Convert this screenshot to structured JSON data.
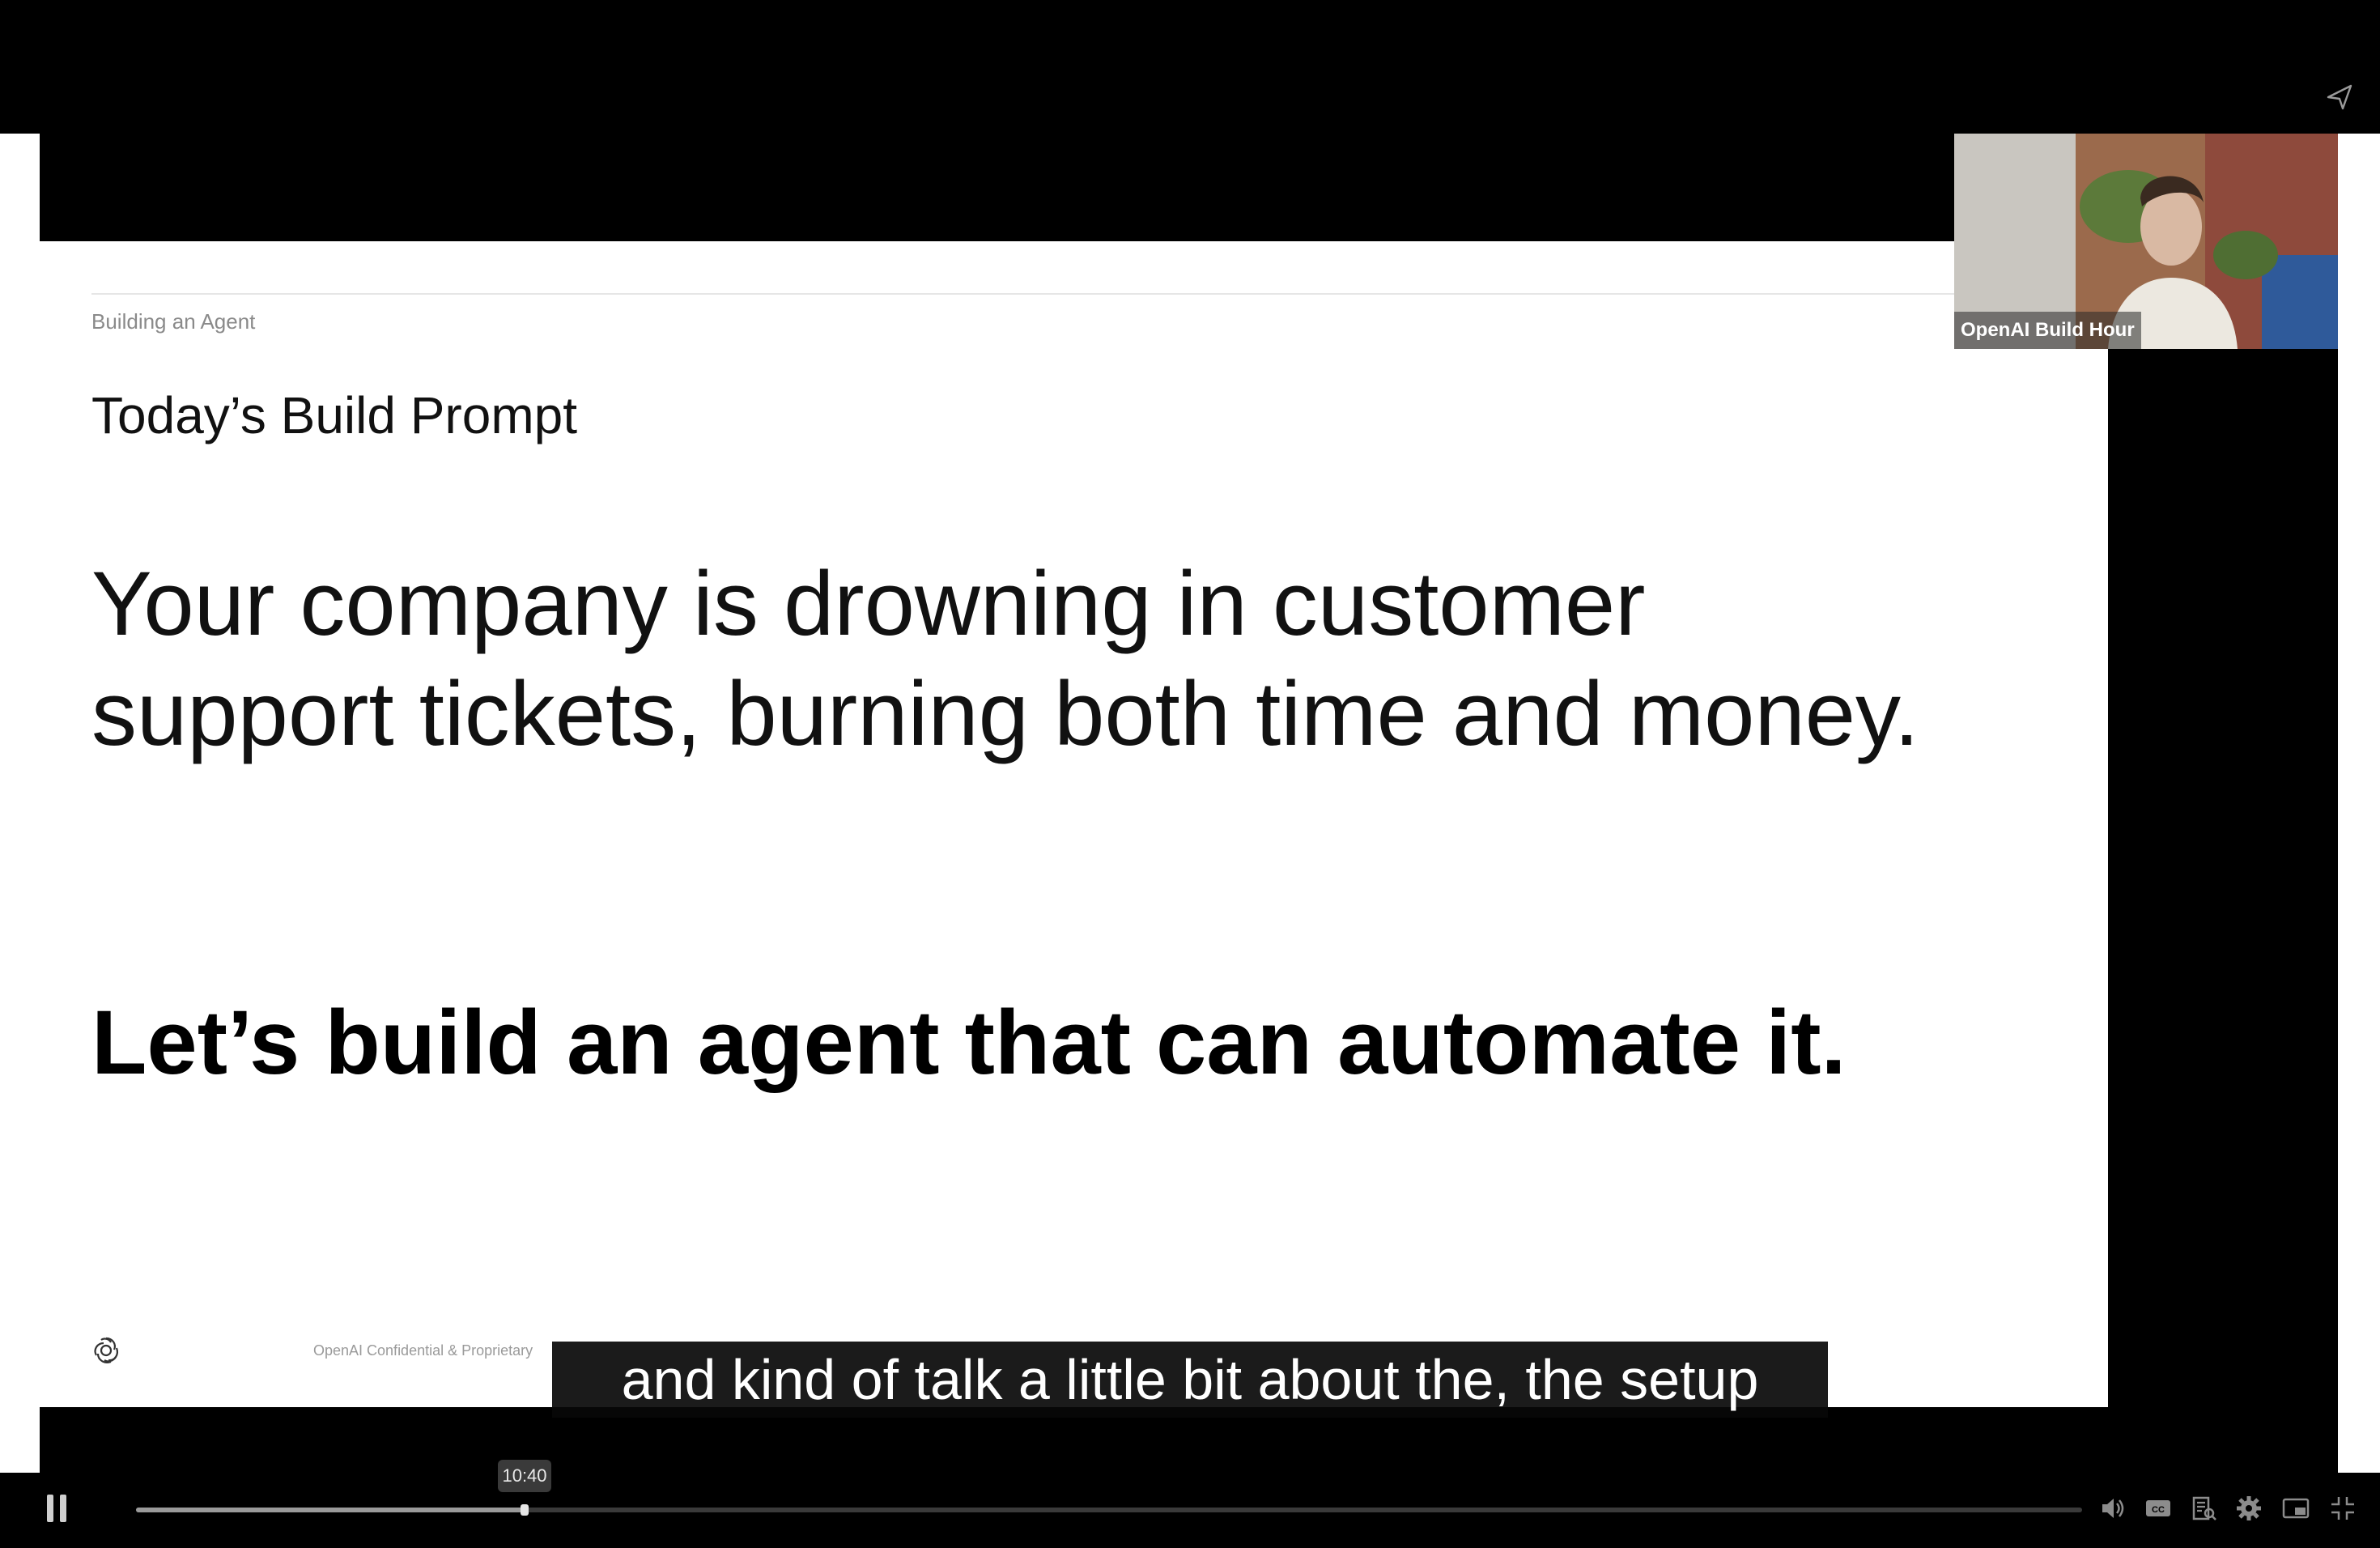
{
  "slide": {
    "breadcrumb": "Building an Agent",
    "title": "Today’s Build Prompt",
    "body": "Your company is drowning in customer support tickets, burning both time and money.",
    "emphasis": "Let’s build an agent that can automate it.",
    "footer": "OpenAI Confidential & Proprietary"
  },
  "speaker": {
    "name_label": "OpenAI Build Hour"
  },
  "captions": {
    "text": "and kind of talk a little bit about the, the setup"
  },
  "player": {
    "current_time_tooltip": "10:40",
    "progress_fraction": 0.1996,
    "icons": [
      "pause-icon",
      "volume-icon",
      "closed-captions-icon",
      "transcript-icon",
      "settings-icon",
      "miniplayer-icon",
      "exit-fullscreen-icon",
      "share-icon"
    ]
  },
  "colors": {
    "background": "#000000",
    "slide": "#ffffff",
    "caption_bg": "#080808",
    "progress_fill": "#9a9a9a"
  }
}
